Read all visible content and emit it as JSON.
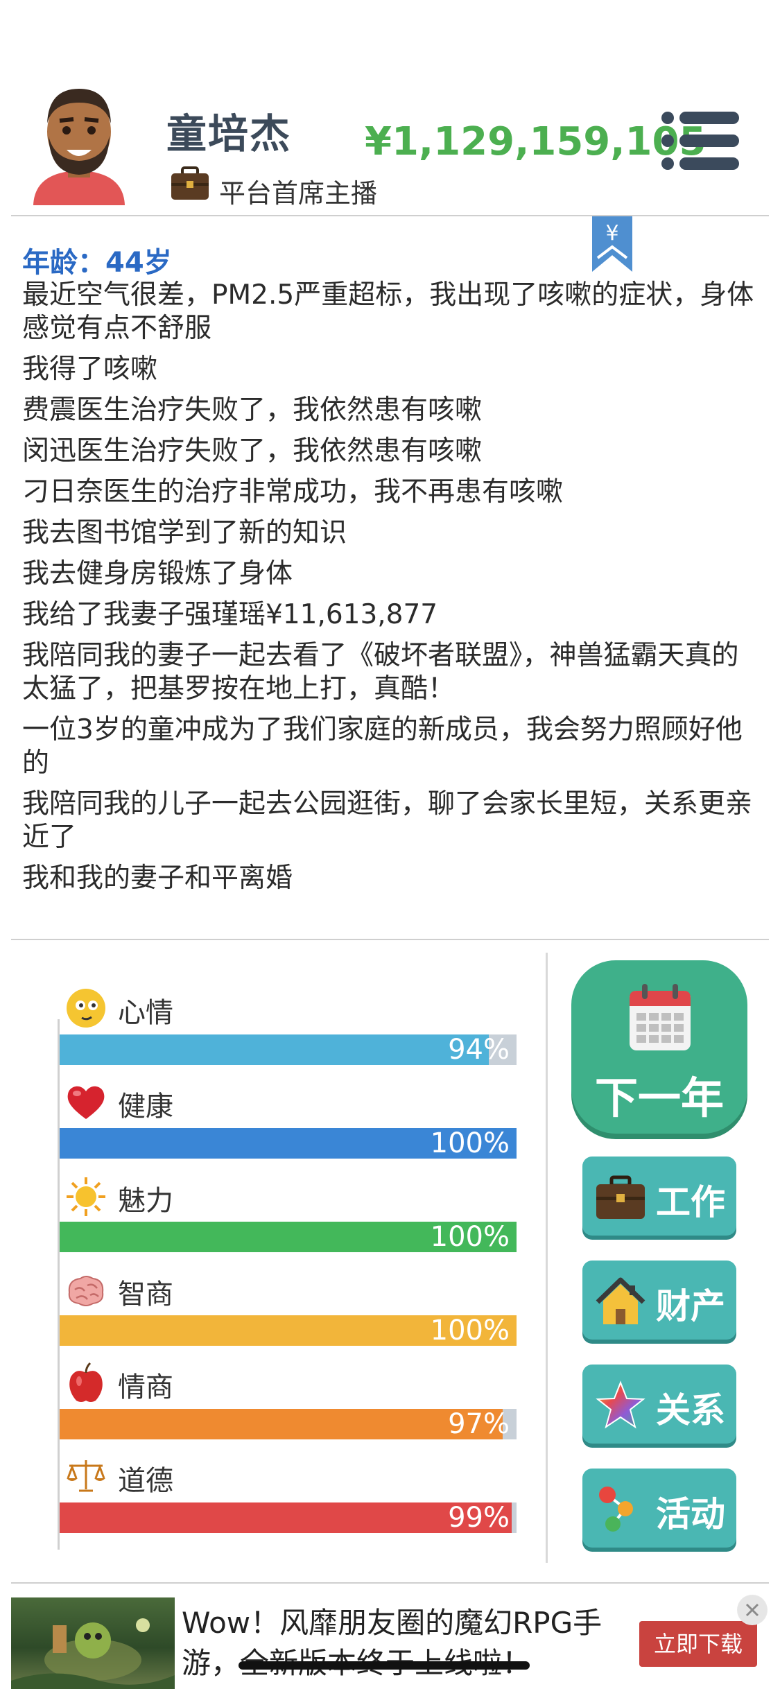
{
  "header": {
    "name": "童培杰",
    "title": "平台首席主播",
    "money": "¥1,129,159,105"
  },
  "log": {
    "bookmark_symbol": "¥",
    "age": "年龄：44岁",
    "entries": [
      "最近空气很差，PM2.5严重超标，我出现了咳嗽的症状，身体感觉有点不舒服",
      "我得了咳嗽",
      "费震医生治疗失败了，我依然患有咳嗽",
      "闵迅医生治疗失败了，我依然患有咳嗽",
      "刁日奈医生的治疗非常成功，我不再患有咳嗽",
      "我去图书馆学到了新的知识",
      "我去健身房锻炼了身体",
      "我给了我妻子强瑾瑶¥11,613,877",
      "我陪同我的妻子一起去看了《破坏者联盟》，神兽猛霸天真的太猛了，把基罗按在地上打，真酷！",
      "一位3岁的童冲成为了我们家庭的新成员，我会努力照顾好他的",
      "我陪同我的儿子一起去公园逛街，聊了会家长里短，关系更亲近了",
      "我和我的妻子和平离婚"
    ]
  },
  "stats": [
    {
      "label": "心情",
      "value": 94,
      "pct_text": "94%",
      "color": "#4fb2d9",
      "icon": "smiley-icon"
    },
    {
      "label": "健康",
      "value": 100,
      "pct_text": "100%",
      "color": "#3a86d6",
      "icon": "heart-icon"
    },
    {
      "label": "魅力",
      "value": 100,
      "pct_text": "100%",
      "color": "#43b85a",
      "icon": "sun-icon"
    },
    {
      "label": "智商",
      "value": 100,
      "pct_text": "100%",
      "color": "#f2b53a",
      "icon": "brain-icon"
    },
    {
      "label": "情商",
      "value": 97,
      "pct_text": "97%",
      "color": "#ef8a30",
      "icon": "apple-icon"
    },
    {
      "label": "道德",
      "value": 99,
      "pct_text": "99%",
      "color": "#e04848",
      "icon": "scales-icon"
    }
  ],
  "actions": {
    "next_year": "下一年",
    "work": "工作",
    "property": "财产",
    "relations": "关系",
    "activities": "活动"
  },
  "ad": {
    "text": "Wow！风靡朋友圈的魔幻RPG手游，全新版本终于上线啦！",
    "button": "立即下载"
  }
}
